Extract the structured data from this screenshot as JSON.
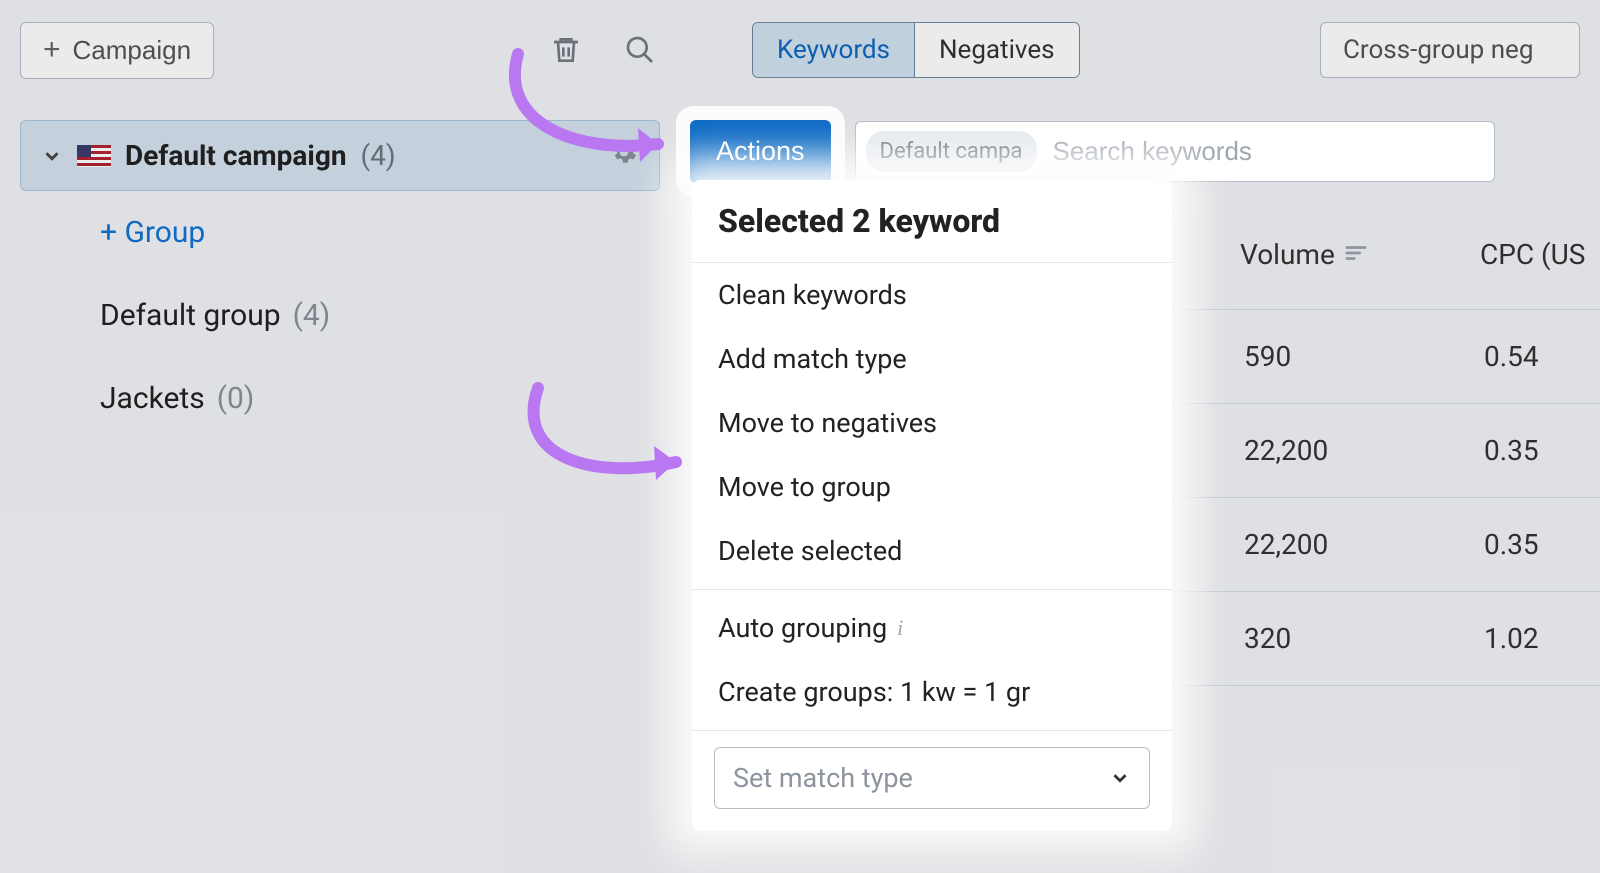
{
  "topbar": {
    "campaign_btn": "Campaign",
    "tab_keywords": "Keywords",
    "tab_negatives": "Negatives",
    "cross_group": "Cross-group neg"
  },
  "sidebar": {
    "campaign_name": "Default campaign",
    "campaign_count": "(4)",
    "add_group": "+ Group",
    "groups": [
      {
        "name": "Default group",
        "count": "(4)"
      },
      {
        "name": "Jackets",
        "count": "(0)"
      }
    ]
  },
  "actions": {
    "label": "Actions",
    "pill": "Default campa",
    "search_placeholder": "Search keywords"
  },
  "popup": {
    "title": "Selected 2 keyword",
    "items_group1": [
      "Clean keywords",
      "Add match type",
      "Move to negatives",
      "Move to group",
      "Delete selected"
    ],
    "auto_grouping": "Auto grouping",
    "create_groups": "Create groups: 1 kw = 1 gr",
    "select_placeholder": "Set match type"
  },
  "columns": {
    "volume": "Volume",
    "cpc": "CPC (US"
  },
  "rows": [
    {
      "volume": "590",
      "cpc": "0.54"
    },
    {
      "volume": "22,200",
      "cpc": "0.35"
    },
    {
      "volume": "22,200",
      "cpc": "0.35"
    },
    {
      "volume": "320",
      "cpc": "1.02"
    }
  ]
}
